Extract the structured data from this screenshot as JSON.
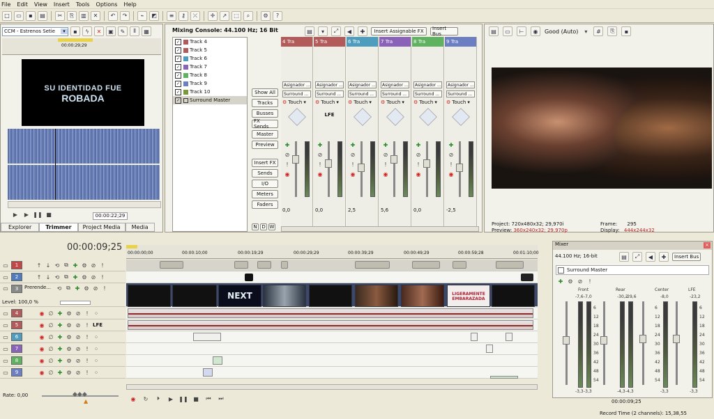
{
  "menu": {
    "items": [
      "File",
      "Edit",
      "View",
      "Insert",
      "Tools",
      "Options",
      "Help"
    ]
  },
  "trimmer": {
    "preset": "CCM - Estrenos Setie",
    "ruler_time": "00:00:29;29",
    "preview_line1": "SU IDENTIDAD FUE",
    "preview_line2": "ROBADA",
    "time": "00:00:22;29",
    "tabs": [
      "Explorer",
      "Trimmer",
      "Project Media",
      "Media"
    ],
    "active_tab": "Trimmer"
  },
  "mixing_console": {
    "title": "Mixing Console: 44.100 Hz; 16 Bit",
    "tracks": [
      "Track 4",
      "Track 5",
      "Track 6",
      "Track 7",
      "Track 8",
      "Track 9",
      "Track 10",
      "Surround Master"
    ],
    "view_buttons": [
      "Show All",
      "Tracks",
      "Busses",
      "FX Sends",
      "Master",
      "Preview",
      "Insert FX",
      "Sends",
      "I/O",
      "Meters",
      "Faders"
    ],
    "small_buttons": [
      "N",
      "D",
      "W"
    ],
    "insert_fx": "Insert Assignable FX",
    "insert_bus": "Insert Bus",
    "strips": [
      {
        "name": "Tra",
        "num": "4",
        "color": "#b35a5a",
        "assign": "Asignador ...",
        "surround": "Surround ...",
        "mode": "Touch",
        "value": "0,0"
      },
      {
        "name": "Tra",
        "num": "5",
        "color": "#b35a5a",
        "assign": "Asignador ...",
        "surround": "Surround ...",
        "mode": "Touch",
        "label": "LFE",
        "value": "0,0"
      },
      {
        "name": "Tra",
        "num": "6",
        "color": "#4f9dbe",
        "assign": "Asignador ...",
        "surround": "Surround ...",
        "mode": "Touch",
        "value": "2,5"
      },
      {
        "name": "Tra",
        "num": "7",
        "color": "#8a63b8",
        "assign": "Asignador ...",
        "surround": "Surround ...",
        "mode": "Touch",
        "value": "5,6"
      },
      {
        "name": "Tra",
        "num": "8",
        "color": "#5fb25f",
        "assign": "Asignador ...",
        "surround": "Surround ...",
        "mode": "Touch",
        "value": "0,0"
      },
      {
        "name": "Tra",
        "num": "9",
        "color": "#6b7fc2",
        "assign": "Asignador ...",
        "surround": "Surround ...",
        "mode": "Touch",
        "value": "-2,5"
      }
    ]
  },
  "preview": {
    "quality": "Good (Auto)",
    "project_label": "Project:",
    "project": "720x480x32; 29,970i",
    "preview_label": "Preview:",
    "preview": "360x240x32; 29,970p",
    "frame_label": "Frame:",
    "frame": "295",
    "display_label": "Display:",
    "display": "444x244x32"
  },
  "timeline": {
    "time": "00:00:09;25",
    "ruler": [
      "00:00:00;00",
      "00:00:10;00",
      "00:00:19;29",
      "00:00:29;29",
      "00:00:39;29",
      "00:00:49;29",
      "00:00:59;28",
      "00:01:10;00"
    ],
    "track3_name": "Prerende...",
    "level": "Level: 100,0 %",
    "lfe": "LFE",
    "rate": "Rate: 0,00",
    "clip_next": "NEXT",
    "clip_title1": "LIGERAMENTE",
    "clip_title2": "EMBARAZADA",
    "tracks": [
      {
        "num": "1",
        "color": "#c24848"
      },
      {
        "num": "2",
        "color": "#4f7bbf"
      },
      {
        "num": "3",
        "color": "#888"
      },
      {
        "num": "4",
        "color": "#b35a5a"
      },
      {
        "num": "5",
        "color": "#b35a5a"
      },
      {
        "num": "6",
        "color": "#4f9dbe"
      },
      {
        "num": "7",
        "color": "#8a63b8"
      },
      {
        "num": "8",
        "color": "#5fb25f"
      },
      {
        "num": "9",
        "color": "#6b7fc2"
      }
    ]
  },
  "mixer": {
    "title": "Mixer",
    "format": "44.100 Hz; 16-bit",
    "insert_bus": "Insert Bus",
    "bus": "Surround Master",
    "channels": [
      "Front",
      "Rear",
      "Center",
      "LFE"
    ],
    "peaks": [
      "-7,6",
      "-7,0",
      "-30,2",
      "-29,6",
      "-8,0",
      "-23,2"
    ],
    "scale": [
      "6",
      "12",
      "18",
      "24",
      "30",
      "36",
      "42",
      "48",
      "54"
    ],
    "bottom": [
      "-3,3",
      "-3,3",
      "-4,3",
      "-4,3",
      "-3,3",
      "-3,3"
    ],
    "time": "00:00:09;25",
    "record": "Record Time (2 channels): 15,38,55"
  }
}
